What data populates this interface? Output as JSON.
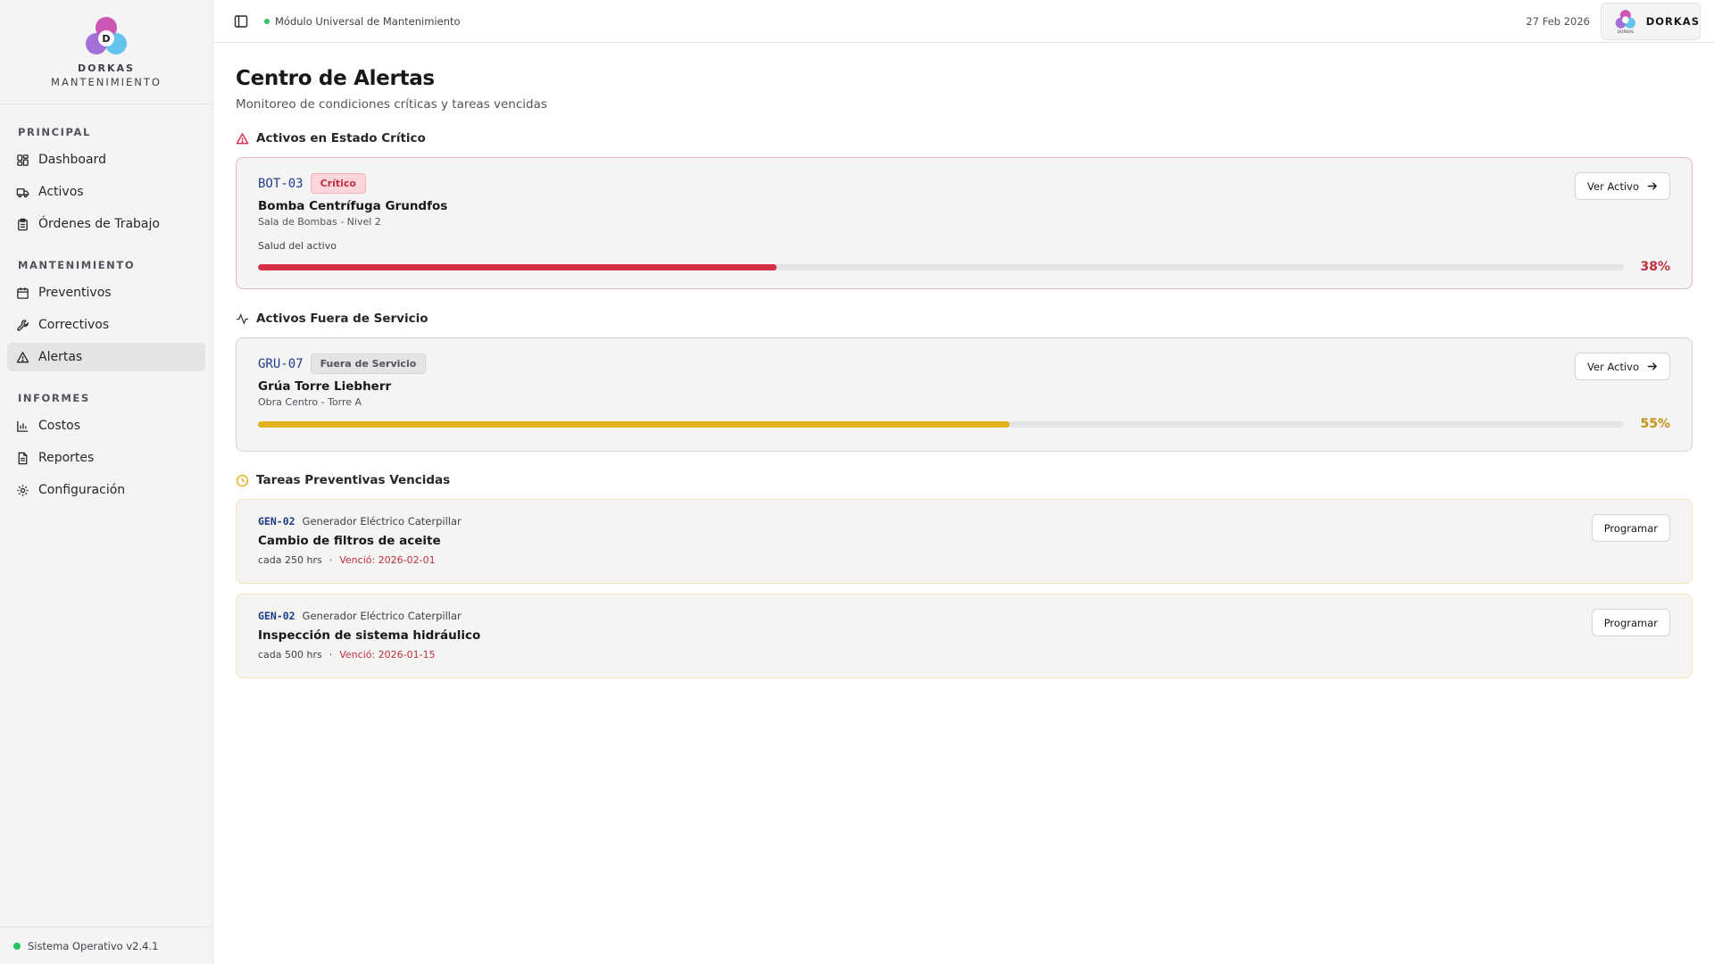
{
  "brand": {
    "name": "DORKAS",
    "subtitle": "MANTENIMIENTO",
    "logo_letter": "D",
    "logo_caption": "DORKAS"
  },
  "sidebar": {
    "sections": [
      {
        "label": "PRINCIPAL",
        "items": [
          {
            "label": "Dashboard",
            "icon": "grid-icon"
          },
          {
            "label": "Activos",
            "icon": "truck-icon"
          },
          {
            "label": "Órdenes de Trabajo",
            "icon": "clipboard-icon"
          }
        ]
      },
      {
        "label": "MANTENIMIENTO",
        "items": [
          {
            "label": "Preventivos",
            "icon": "calendar-icon"
          },
          {
            "label": "Correctivos",
            "icon": "wrench-icon"
          },
          {
            "label": "Alertas",
            "icon": "alert-triangle-icon",
            "active": true
          }
        ]
      },
      {
        "label": "INFORMES",
        "items": [
          {
            "label": "Costos",
            "icon": "bar-chart-icon"
          },
          {
            "label": "Reportes",
            "icon": "file-text-icon"
          },
          {
            "label": "Configuración",
            "icon": "gear-icon"
          }
        ]
      }
    ],
    "footer": "Sistema Operativo v2.4.1"
  },
  "header": {
    "module": "Módulo Universal de Mantenimiento",
    "date": "27 Feb 2026",
    "user": "DORKAS"
  },
  "page": {
    "title": "Centro de Alertas",
    "subtitle": "Monitoreo de condiciones críticas y tareas vencidas"
  },
  "critical": {
    "title": "Activos en Estado Crítico",
    "asset": {
      "code": "BOT-03",
      "badge": "Crítico",
      "name": "Bomba Centrífuga Grundfos",
      "location": "Sala de Bombas - Nivel 2",
      "health_label": "Salud del activo",
      "health": 38,
      "health_text": "38%",
      "button": "Ver Activo"
    }
  },
  "outservice": {
    "title": "Activos Fuera de Servicio",
    "asset": {
      "code": "GRU-07",
      "badge": "Fuera de Servicio",
      "name": "Grúa Torre Liebherr",
      "location": "Obra Centro - Torre A",
      "health": 55,
      "health_text": "55%",
      "button": "Ver Activo"
    }
  },
  "overdue": {
    "title": "Tareas Preventivas Vencidas",
    "tasks": [
      {
        "code": "GEN-02",
        "asset": "Generador Eléctrico Caterpillar",
        "name": "Cambio de filtros de aceite",
        "interval": "cada 250 hrs",
        "separator": "·",
        "due": "Venció: 2026-02-01",
        "button": "Programar"
      },
      {
        "code": "GEN-02",
        "asset": "Generador Eléctrico Caterpillar",
        "name": "Inspección de sistema hidráulico",
        "interval": "cada 500 hrs",
        "separator": "·",
        "due": "Venció: 2026-01-15",
        "button": "Programar"
      }
    ]
  },
  "colors": {
    "critical": "#d42f45",
    "warning": "#e2b21c",
    "critical_text": "#c0303f",
    "warning_text": "#c4911a"
  }
}
